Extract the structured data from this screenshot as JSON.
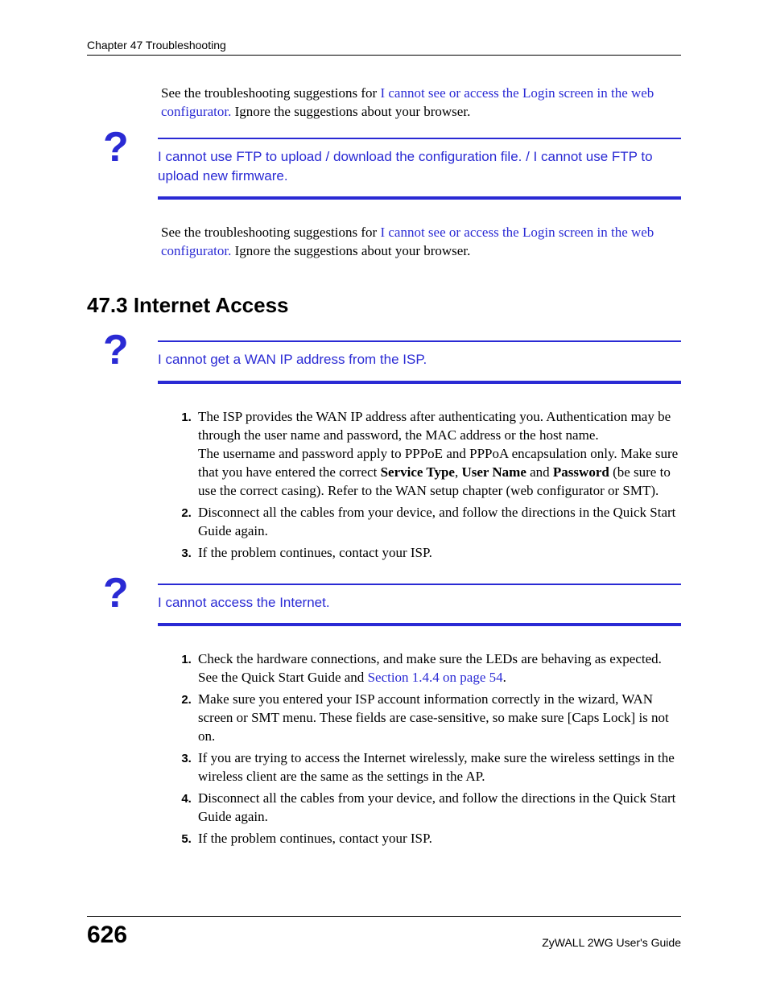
{
  "header": "Chapter 47 Troubleshooting",
  "para1_pre": "See the troubleshooting suggestions for ",
  "para1_link": "I cannot see or access the Login screen in the web configurator.",
  "para1_post": " Ignore the suggestions about your browser.",
  "block1_title": "I cannot use FTP to upload / download the configuration file. / I cannot use FTP to upload new firmware.",
  "para2_pre": "See the troubleshooting suggestions for ",
  "para2_link": "I cannot see or access the Login screen in the web configurator.",
  "para2_post": " Ignore the suggestions about your browser.",
  "section_heading": "47.3  Internet Access",
  "block2_title": "I cannot get a WAN IP address from the ISP.",
  "list1": {
    "i1a": "The ISP provides the WAN IP address after authenticating you. Authentication may be through the user name and password, the MAC address or the host name.",
    "i1b_pre": "The username and password apply to PPPoE and PPPoA encapsulation only. Make sure that you have entered the correct ",
    "i1b_bold1": "Service Type",
    "i1b_mid1": ", ",
    "i1b_bold2": "User Name",
    "i1b_mid2": " and ",
    "i1b_bold3": "Password",
    "i1b_post": " (be sure to use the correct casing). Refer to the WAN setup chapter (web configurator or SMT).",
    "i2": "Disconnect all the cables from your device, and follow the directions in the Quick Start Guide again.",
    "i3": "If the problem continues, contact your ISP."
  },
  "block3_title": "I cannot access the Internet.",
  "list2": {
    "i1_pre": "Check the hardware connections, and make sure the LEDs are behaving as expected. See the Quick Start Guide and ",
    "i1_link": "Section 1.4.4 on page 54",
    "i1_post": ".",
    "i2": "Make sure you entered your ISP account information correctly in the wizard, WAN screen or SMT menu. These fields are case-sensitive, so make sure [Caps Lock] is not on.",
    "i3": "If you are trying to access the Internet wirelessly, make sure the wireless settings in the wireless client are the same as the settings in the AP.",
    "i4": "Disconnect all the cables from your device, and follow the directions in the Quick Start Guide again.",
    "i5": "If the problem continues, contact your ISP."
  },
  "footer": {
    "page": "626",
    "guide": "ZyWALL 2WG User's Guide"
  },
  "qmark": "?"
}
